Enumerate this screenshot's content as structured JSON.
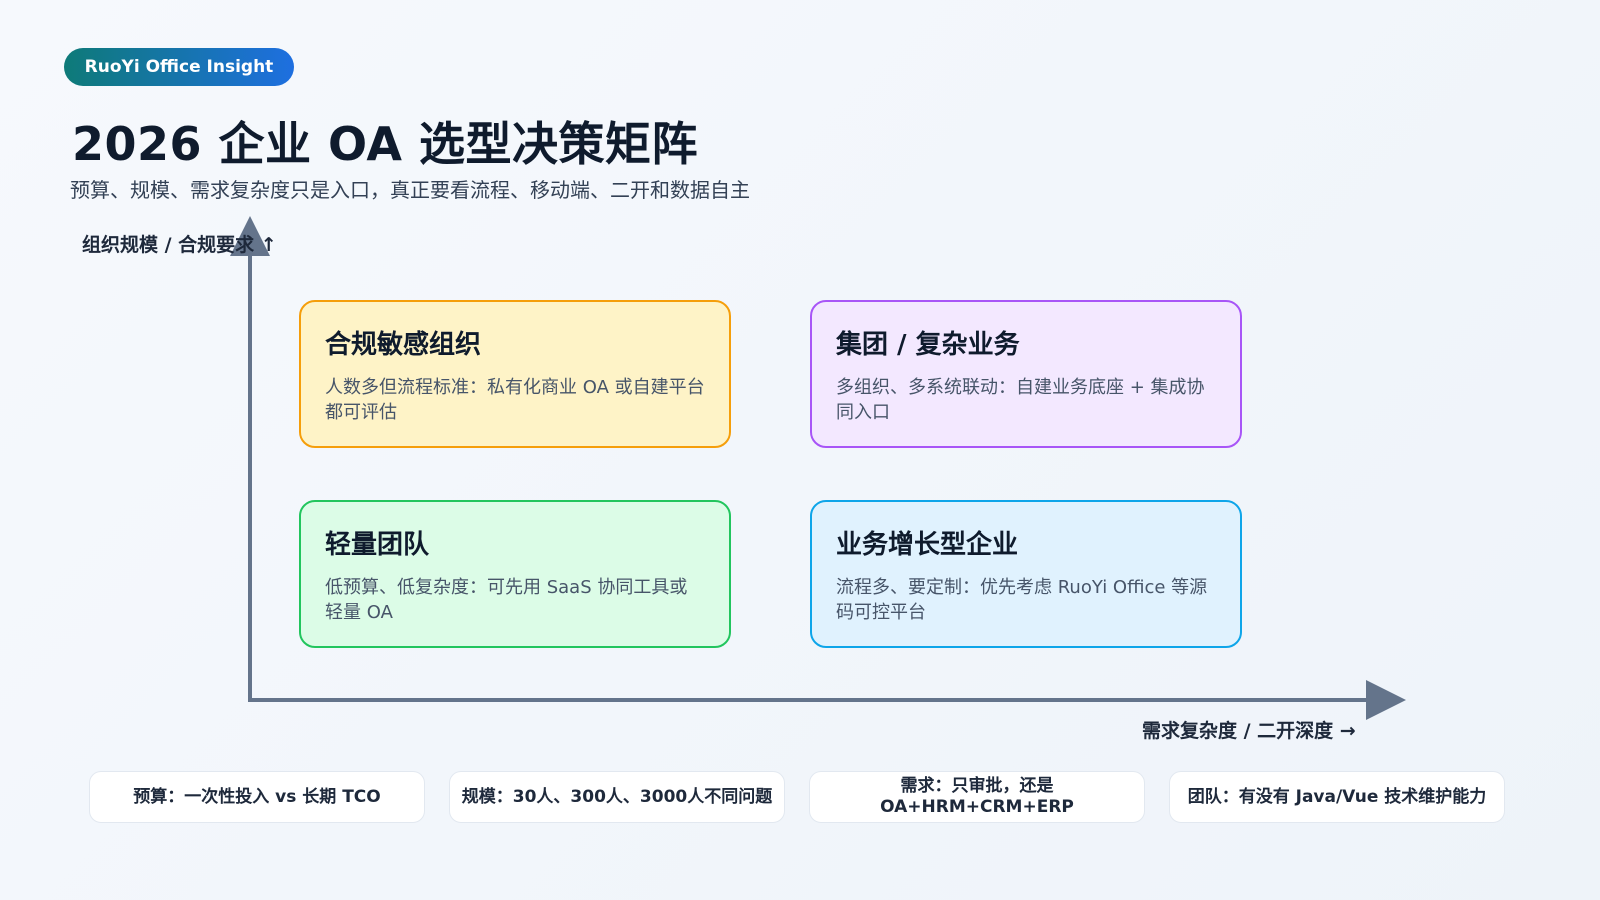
{
  "badge": "RuoYi Office Insight",
  "title": "2026 企业 OA 选型决策矩阵",
  "subtitle": "预算、规模、需求复杂度只是入口，真正要看流程、移动端、二开和数据自主",
  "axes": {
    "y_label": "组织规模 / 合规要求 ↑",
    "x_label": "需求复杂度 / 二开深度 →"
  },
  "quadrants": [
    {
      "title": "合规敏感组织",
      "text": "人数多但流程标准：私有化商业 OA 或自建平台都可评估"
    },
    {
      "title": "集团 / 复杂业务",
      "text": "多组织、多系统联动：自建业务底座 + 集成协同入口"
    },
    {
      "title": "轻量团队",
      "text": "低预算、低复杂度：可先用 SaaS 协同工具或轻量 OA"
    },
    {
      "title": "业务增长型企业",
      "text": "流程多、要定制：优先考虑 RuoYi Office 等源码可控平台"
    }
  ],
  "factors": [
    {
      "line1": "预算：一次性投入 vs 长期 TCO",
      "line2": ""
    },
    {
      "line1": "规模：30人、300人、3000人不同问题",
      "line2": ""
    },
    {
      "line1": "需求：只审批，还是",
      "line2": "OA+HRM+CRM+ERP"
    },
    {
      "line1": "团队：有没有 Java/Vue 技术维护能力",
      "line2": ""
    }
  ],
  "colors": {
    "badge_start": "#0e7a78",
    "badge_end": "#1e6fe0",
    "axis": "#64748b",
    "q1_fill": "#fef3c7",
    "q1_border": "#f59e0b",
    "q2_fill": "#f3e8ff",
    "q2_border": "#a855f7",
    "q3_fill": "#dcfce7",
    "q3_border": "#22c55e",
    "q4_fill": "#e0f2fe",
    "q4_border": "#0ea5e9"
  }
}
